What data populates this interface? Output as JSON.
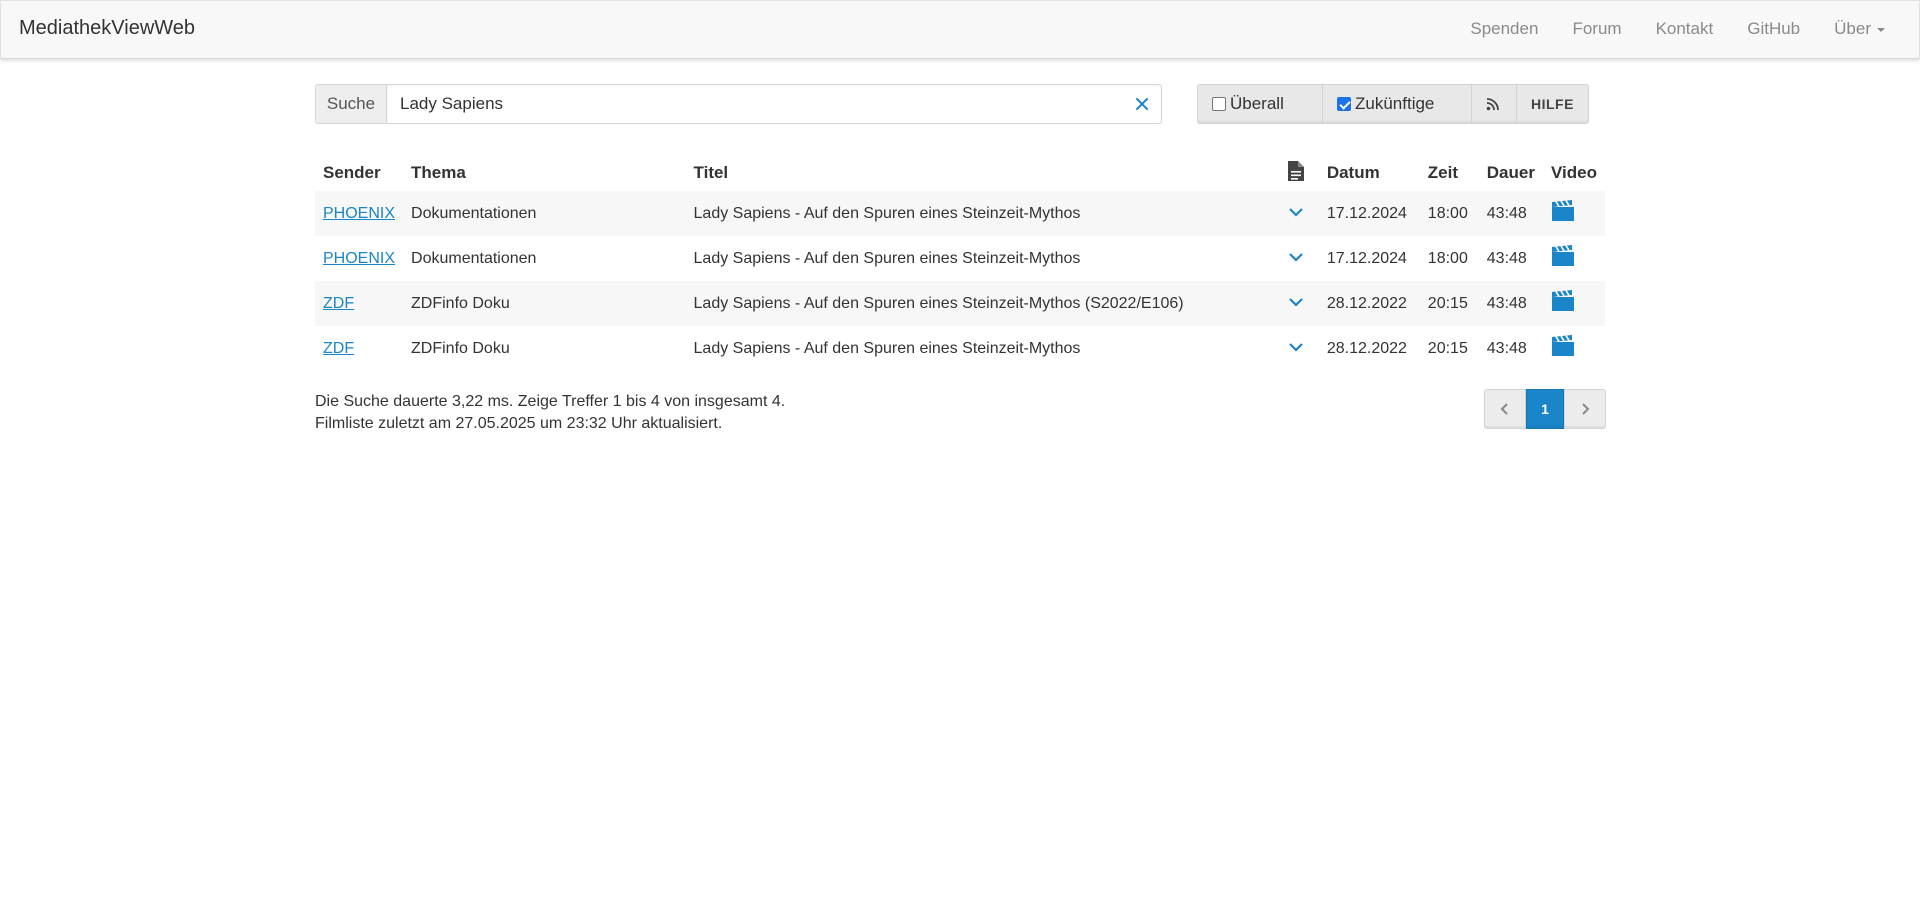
{
  "navbar": {
    "brand": "MediathekViewWeb",
    "links": [
      "Spenden",
      "Forum",
      "Kontakt",
      "GitHub",
      "Über"
    ]
  },
  "search": {
    "addon_label": "Suche",
    "value": "Lady Sapiens"
  },
  "toggles": {
    "everywhere_label": "Überall",
    "everywhere_checked": false,
    "future_label": "Zukünftige",
    "future_checked": true,
    "help_label": "HILFE"
  },
  "table": {
    "headers": {
      "sender": "Sender",
      "thema": "Thema",
      "titel": "Titel",
      "datum": "Datum",
      "zeit": "Zeit",
      "dauer": "Dauer",
      "video": "Video"
    },
    "rows": [
      {
        "sender": "PHOENIX",
        "thema": "Dokumentationen",
        "titel": "Lady Sapiens - Auf den Spuren eines Steinzeit-Mythos",
        "datum": "17.12.2024",
        "zeit": "18:00",
        "dauer": "43:48"
      },
      {
        "sender": "PHOENIX",
        "thema": "Dokumentationen",
        "titel": "Lady Sapiens - Auf den Spuren eines Steinzeit-Mythos",
        "datum": "17.12.2024",
        "zeit": "18:00",
        "dauer": "43:48"
      },
      {
        "sender": "ZDF",
        "thema": "ZDFinfo Doku",
        "titel": "Lady Sapiens - Auf den Spuren eines Steinzeit-Mythos (S2022/E106)",
        "datum": "28.12.2022",
        "zeit": "20:15",
        "dauer": "43:48"
      },
      {
        "sender": "ZDF",
        "thema": "ZDFinfo Doku",
        "titel": "Lady Sapiens - Auf den Spuren eines Steinzeit-Mythos",
        "datum": "28.12.2022",
        "zeit": "20:15",
        "dauer": "43:48"
      }
    ]
  },
  "status": {
    "line1": "Die Suche dauerte 3,22 ms. Zeige Treffer 1 bis 4 von insgesamt 4.",
    "line2": "Filmliste zuletzt am 27.05.2025 um 23:32 Uhr aktualisiert."
  },
  "pagination": {
    "current_page": "1"
  },
  "colors": {
    "link": "#1a85c8",
    "accent": "#1a85c8",
    "checkbox": "#1a73e8"
  }
}
